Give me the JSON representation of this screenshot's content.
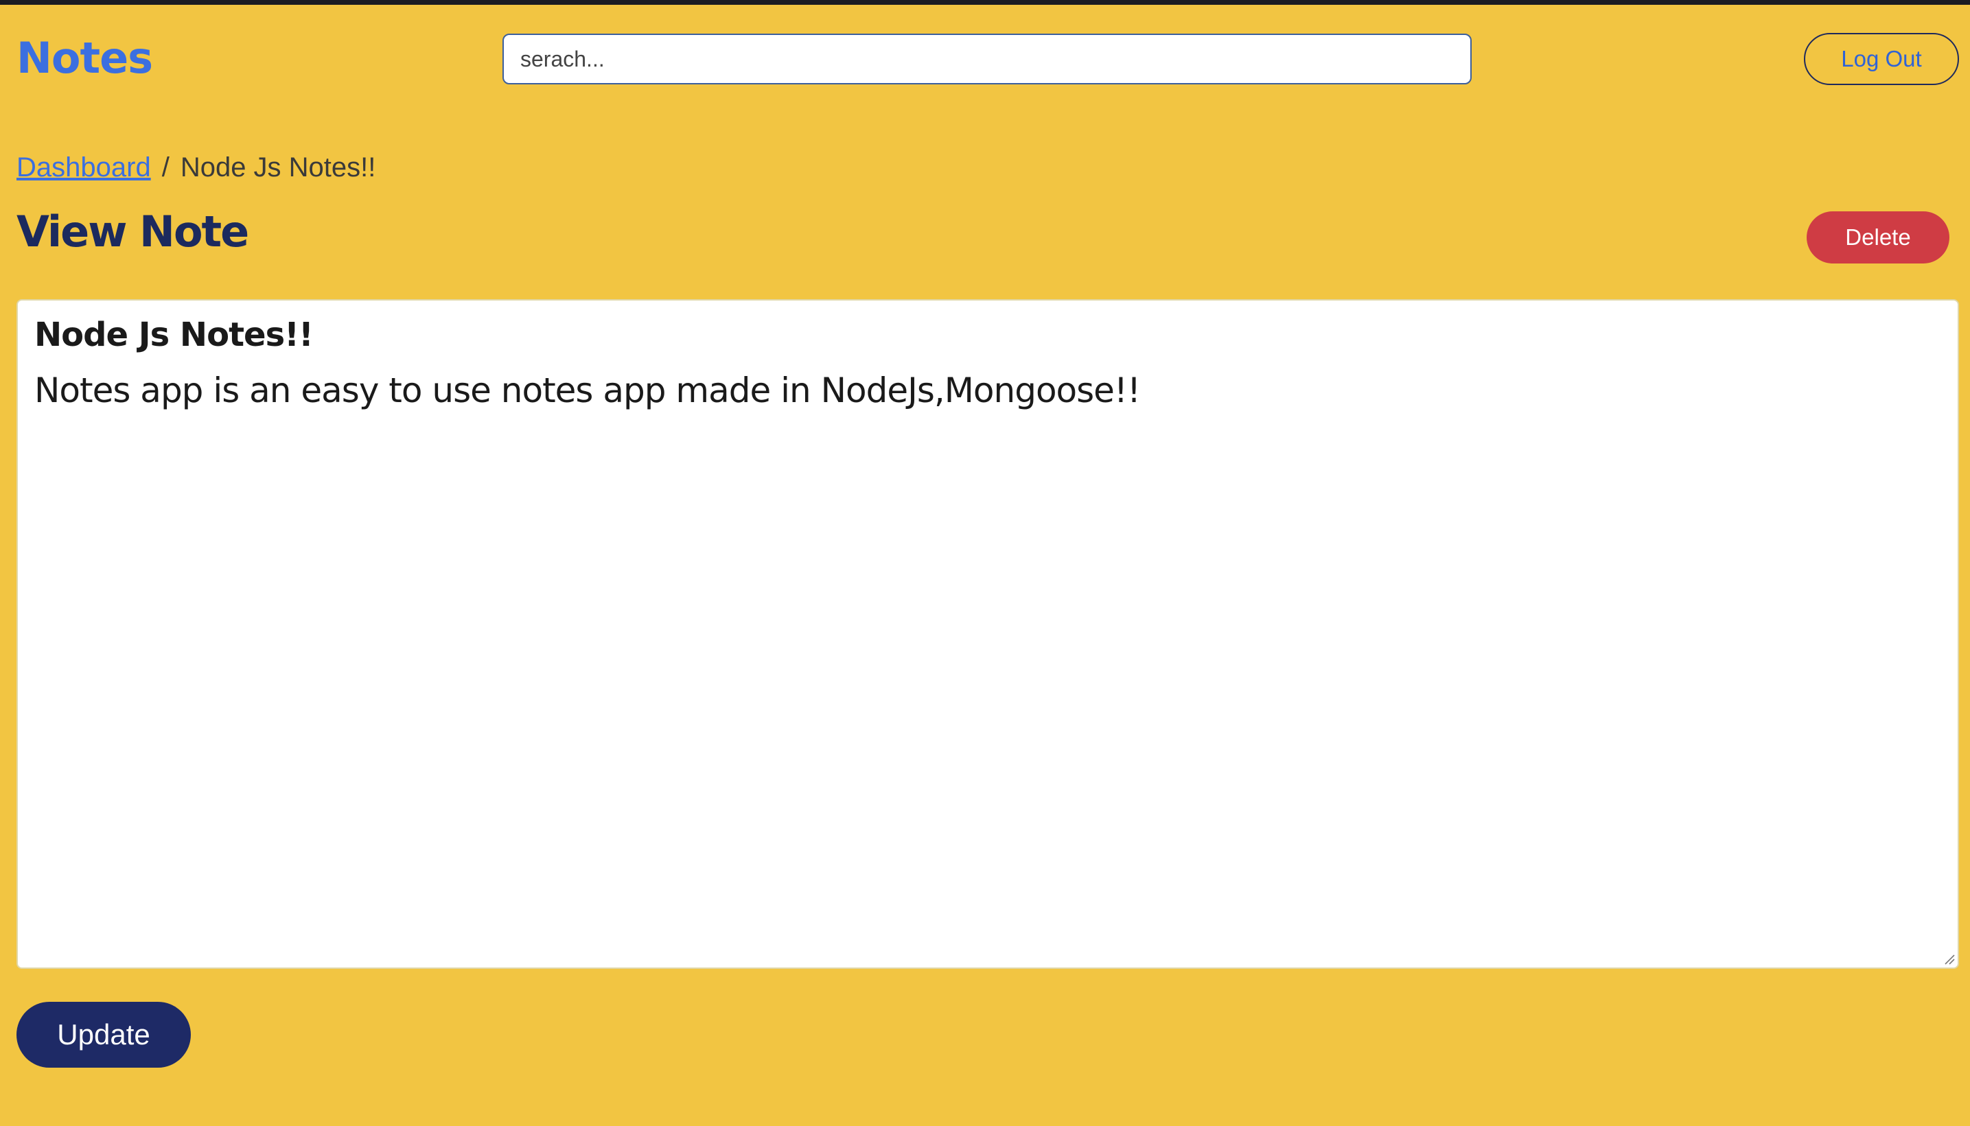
{
  "header": {
    "brand": "Notes",
    "search_placeholder": "serach...",
    "logout_label": "Log Out"
  },
  "breadcrumb": {
    "home": "Dashboard",
    "separator": "/",
    "current": "Node Js Notes!!"
  },
  "page": {
    "title": "View Note",
    "delete_label": "Delete"
  },
  "note": {
    "title": "Node Js Notes!!",
    "body": "Notes app is an easy to use notes app made in NodeJs,Mongoose!!"
  },
  "actions": {
    "update_label": "Update"
  },
  "colors": {
    "background": "#f2c542",
    "brand": "#3b6fe0",
    "title": "#1c2a5e",
    "delete": "#cf3c44",
    "update": "#1e2a66"
  }
}
